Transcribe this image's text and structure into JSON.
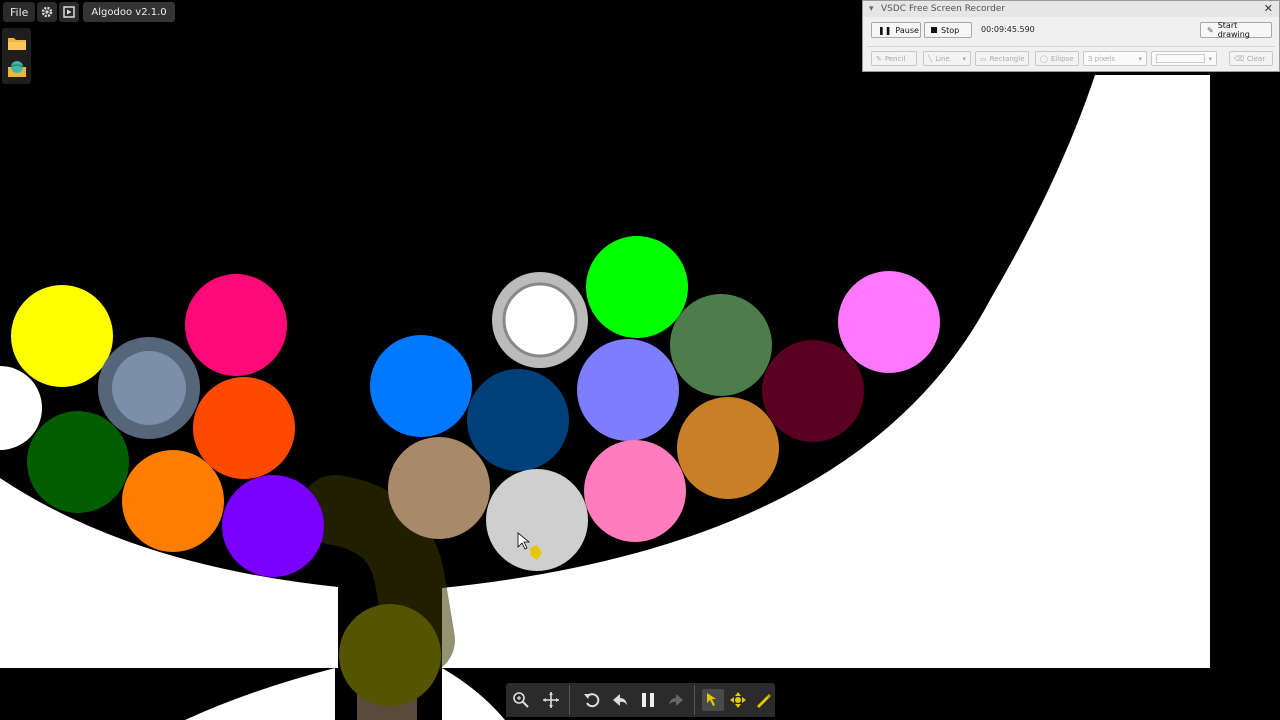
{
  "app": {
    "menu_file": "File",
    "title": "Algodoo v2.1.0",
    "icons": [
      "gear-icon",
      "scene-icon",
      "folder-icon",
      "scene-browser-icon"
    ]
  },
  "recorder": {
    "title": "VSDC Free Screen Recorder",
    "close": "✕",
    "pause_label": "Pause",
    "stop_label": "Stop",
    "time": "00:09:45.590",
    "start_drawing_label": "Start drawing",
    "tools": {
      "pencil": "Pencil",
      "line": "Line",
      "rectangle": "Rectangle",
      "ellipse": "Ellipse",
      "pixels": "3 pixels",
      "clear": "Clear"
    }
  },
  "toolbar": {
    "icons": [
      "zoom-icon",
      "move-icon",
      "undo-icon",
      "back-icon",
      "pause-icon",
      "redo-icon",
      "drag-tool-icon",
      "move-tool-icon",
      "sketch-tool-icon"
    ],
    "active_tool": "drag-tool-icon"
  },
  "colors": {
    "background": "#000000",
    "ground": "#ffffff",
    "toolbar": "#2b2b2b",
    "active_tool": "#e6c800"
  },
  "balls": [
    {
      "name": "yellow",
      "color": "#ffff00"
    },
    {
      "name": "pink-red",
      "color": "#ff0a78"
    },
    {
      "name": "white-left",
      "color": "#ffffff"
    },
    {
      "name": "grey-blue",
      "color": "#7a8fa8"
    },
    {
      "name": "red-orange",
      "color": "#ff4a00"
    },
    {
      "name": "dark-green",
      "color": "#005d00"
    },
    {
      "name": "orange",
      "color": "#ff7d00"
    },
    {
      "name": "purple",
      "color": "#7a00ff"
    },
    {
      "name": "blue",
      "color": "#0078ff"
    },
    {
      "name": "dark-blue",
      "color": "#00407a"
    },
    {
      "name": "white-wheel",
      "color": "#ffffff"
    },
    {
      "name": "green",
      "color": "#00ff00"
    },
    {
      "name": "periwinkle",
      "color": "#7d7dff"
    },
    {
      "name": "sage",
      "color": "#4d7d4d"
    },
    {
      "name": "maroon",
      "color": "#5a0020"
    },
    {
      "name": "violet-pink",
      "color": "#ff78ff"
    },
    {
      "name": "tan",
      "color": "#a88a6a"
    },
    {
      "name": "light-grey",
      "color": "#cfcfcf"
    },
    {
      "name": "pink",
      "color": "#ff7dbd"
    },
    {
      "name": "caramel",
      "color": "#c97e28"
    },
    {
      "name": "olive",
      "color": "#555500"
    }
  ]
}
